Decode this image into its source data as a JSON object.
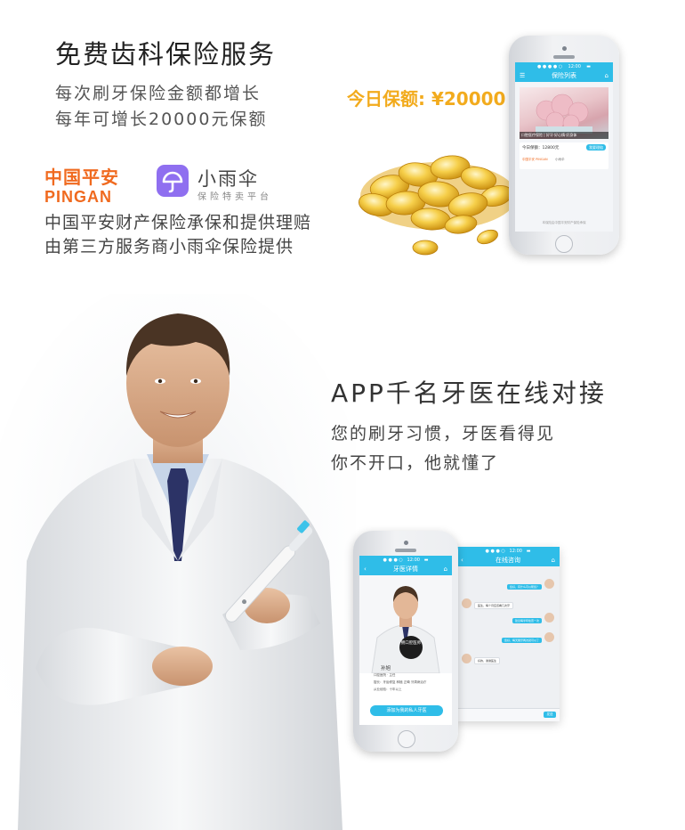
{
  "header": {
    "title": "免费齿科保险服务",
    "subtitle_1": "每次刷牙保险金额都增长",
    "subtitle_2": "每年可增长20000元保额"
  },
  "partners": {
    "pingan_cn": "中国平安",
    "pingan_en": "PINGAN",
    "xiaoyusan_name": "小雨伞",
    "xiaoyusan_tagline": "保险特卖平台"
  },
  "insurer_note": {
    "line_1": "中国平安财产保险承保和提供理赔",
    "line_2": "由第三方服务商小雨伞保险提供"
  },
  "promo": {
    "daily_coverage": "今日保额: ¥20000"
  },
  "phone_insurance": {
    "nav_title": "保险列表",
    "banner_caption": "口腔医疗保险 | 好牙·好心情·好身体",
    "today_label": "今日保额：12800元",
    "apply_button": "我要理赔",
    "partner_label": "中国平安 PINGAN",
    "partner_note": "小雨伞",
    "footer_note": "本保险由中国平安财产保险承保"
  },
  "section_app": {
    "title": "APP千名牙医在线对接",
    "line_1": "您的刷牙习惯，牙医看得见",
    "line_2": "你不开口，他就懂了"
  },
  "phone_dentist": {
    "nav_title": "牙医详情",
    "badge_text": "拥口腔医师",
    "doctor_name": "孙旭",
    "row_1": "口腔医院 · 主任",
    "row_2": "擅长：牙齿修复 种植 正畸 牙周病治疗",
    "row_3": "从业经验：十年以上",
    "add_button": "添加为我的私人牙医"
  },
  "phone_chat": {
    "nav_title": "在线咨询",
    "send_label": "发送",
    "messages": [
      "您好，有什么可以帮您？",
      "医生，每个月应该看几次牙",
      "建议每半年检查一次",
      "您好，每天刷牙两次就可以了",
      "好的，谢谢医生"
    ]
  }
}
